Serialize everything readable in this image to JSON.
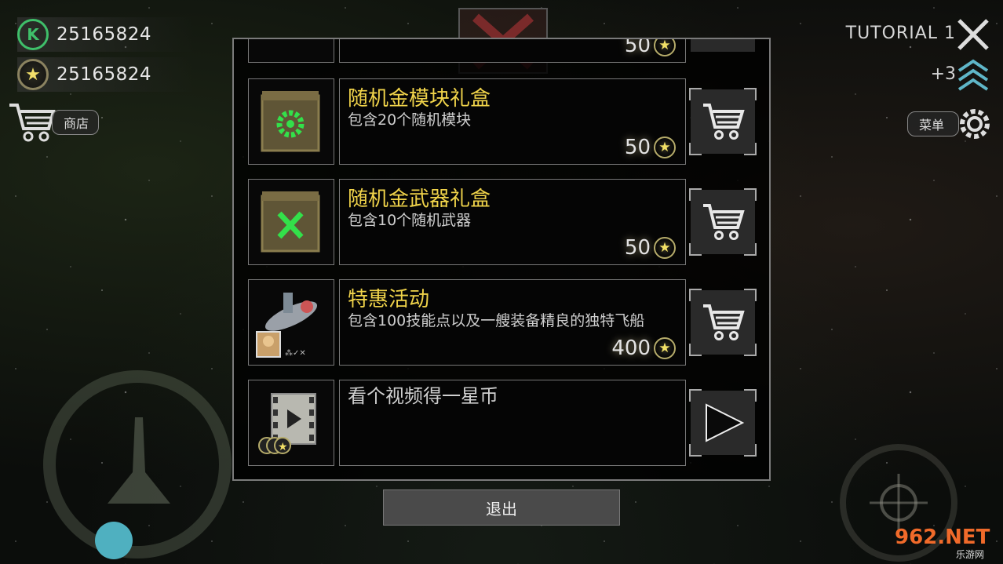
{
  "currencies": {
    "credits": "25165824",
    "stars": "25165824"
  },
  "shop_label": "商店",
  "tutorial_label": "TUTORIAL 1",
  "rank_bonus": "+3",
  "menu_label": "菜单",
  "items": [
    {
      "title": "随机金模块礼盒",
      "desc": "包含20个随机模块",
      "price": "50",
      "icon": "gear-crate-icon",
      "action": "cart"
    },
    {
      "title": "随机金武器礼盒",
      "desc": "包含10个随机武器",
      "price": "50",
      "icon": "swords-crate-icon",
      "action": "cart"
    },
    {
      "title": "特惠活动",
      "desc": "包含100技能点以及一艘装备精良的独特飞船",
      "price": "400",
      "icon": "spaceship-icon",
      "action": "cart"
    },
    {
      "title": "",
      "desc": "看个视频得一星币",
      "price": "",
      "icon": "video-film-icon",
      "action": "play"
    }
  ],
  "partial_top_price": "50",
  "exit_label": "退出",
  "watermark": {
    "main": "962.NET",
    "sub": "乐游网"
  },
  "colors": {
    "accent_gold": "#f0d34a",
    "credit_green": "#3fbf6a"
  }
}
